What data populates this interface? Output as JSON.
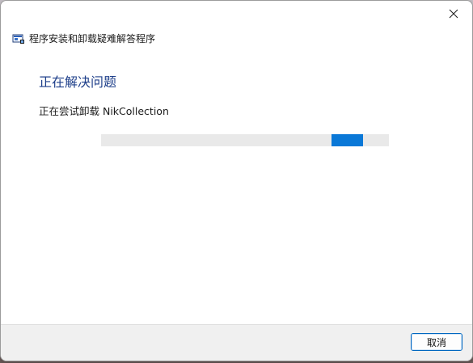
{
  "window": {
    "title": "程序安装和卸载疑难解答程序",
    "close_icon": "close-icon",
    "app_icon": "troubleshooter-icon"
  },
  "main": {
    "heading": "正在解决问题",
    "status": "正在尝试卸载 NikCollection",
    "progress": {
      "style": "indeterminate-marquee",
      "accent": "#0a78d7",
      "track": "#e9e9e9"
    }
  },
  "footer": {
    "cancel_label": "取消"
  },
  "colors": {
    "heading": "#1e3f8a",
    "button_border": "#0067c0",
    "footer_bg": "#f0f0f0"
  }
}
